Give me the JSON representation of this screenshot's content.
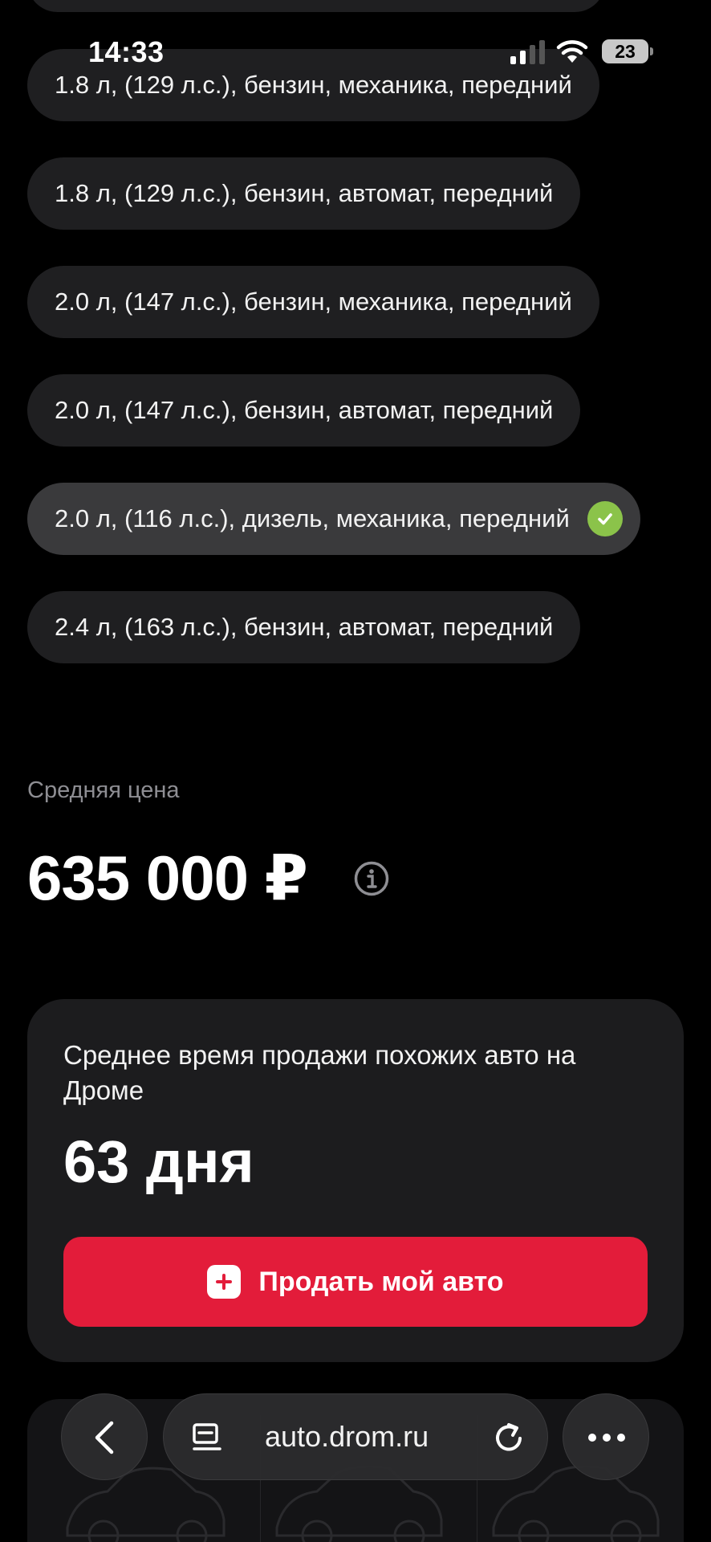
{
  "status_bar": {
    "time": "14:33",
    "battery": "23"
  },
  "options": [
    {
      "label": "1.8 л, (129 л.с.), бензин, механика, передний",
      "selected": false
    },
    {
      "label": "1.8 л, (129 л.с.), бензин, автомат, передний",
      "selected": false
    },
    {
      "label": "2.0 л, (147 л.с.), бензин, механика, передний",
      "selected": false
    },
    {
      "label": "2.0 л, (147 л.с.), бензин, автомат, передний",
      "selected": false
    },
    {
      "label": "2.0 л, (116 л.с.), дизель, механика, передний",
      "selected": true
    },
    {
      "label": "2.4 л, (163 л.с.), бензин, автомат, передний",
      "selected": false
    }
  ],
  "price": {
    "label": "Средняя цена",
    "value": "635 000 ₽"
  },
  "sale_card": {
    "text": "Среднее время продажи похожих авто на Дроме",
    "value": "63 дня",
    "button_label": "Продать мой авто"
  },
  "browser": {
    "url": "auto.drom.ru"
  },
  "colors": {
    "accent_red": "#e31c3a",
    "check_green": "#8bc34a",
    "background": "#000000"
  },
  "icons": [
    "check-icon",
    "info-icon",
    "plus-icon",
    "back-icon",
    "reader-icon",
    "reload-icon",
    "more-icon"
  ]
}
